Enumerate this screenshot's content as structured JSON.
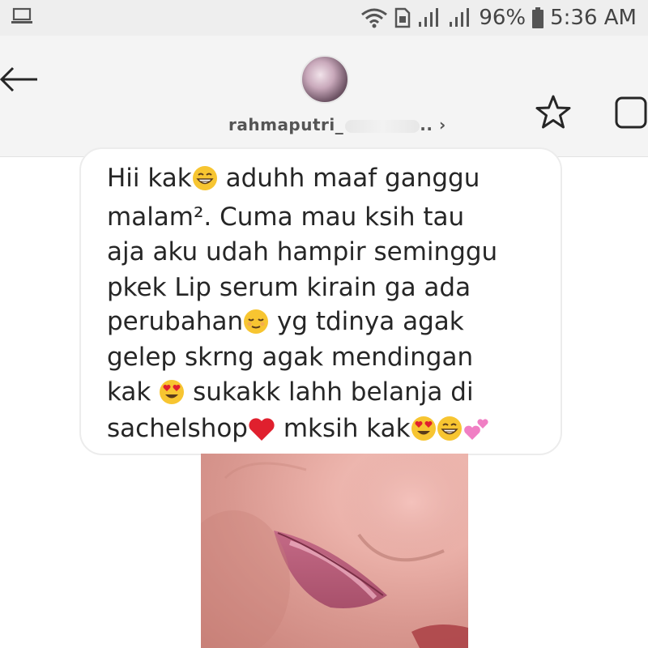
{
  "status_bar": {
    "battery": "96%",
    "time": "5:36 AM"
  },
  "header": {
    "username": "rahmaputri_",
    "username_suffix": "..",
    "chevron": "›",
    "icons": [
      "back-arrow-icon",
      "star-icon",
      "square-icon"
    ]
  },
  "message": {
    "lines": [
      "Hii kak",
      " aduhh maaf ganggu",
      "malam². Cuma mau ksih tau",
      "aja aku udah hampir seminggu",
      "pkek Lip serum kirain ga ada",
      "perubahan",
      " yg tdinya agak",
      "gelep skrng agak mendingan",
      "kak ",
      " sukakk lahh belanja di",
      "sachelshop",
      " mksih kak"
    ]
  },
  "colors": {
    "status_bar_bg": "#eeeeee",
    "header_bg": "#f4f4f4",
    "bubble_border": "#ececec",
    "text": "#262626",
    "heart": "#e0202e"
  }
}
